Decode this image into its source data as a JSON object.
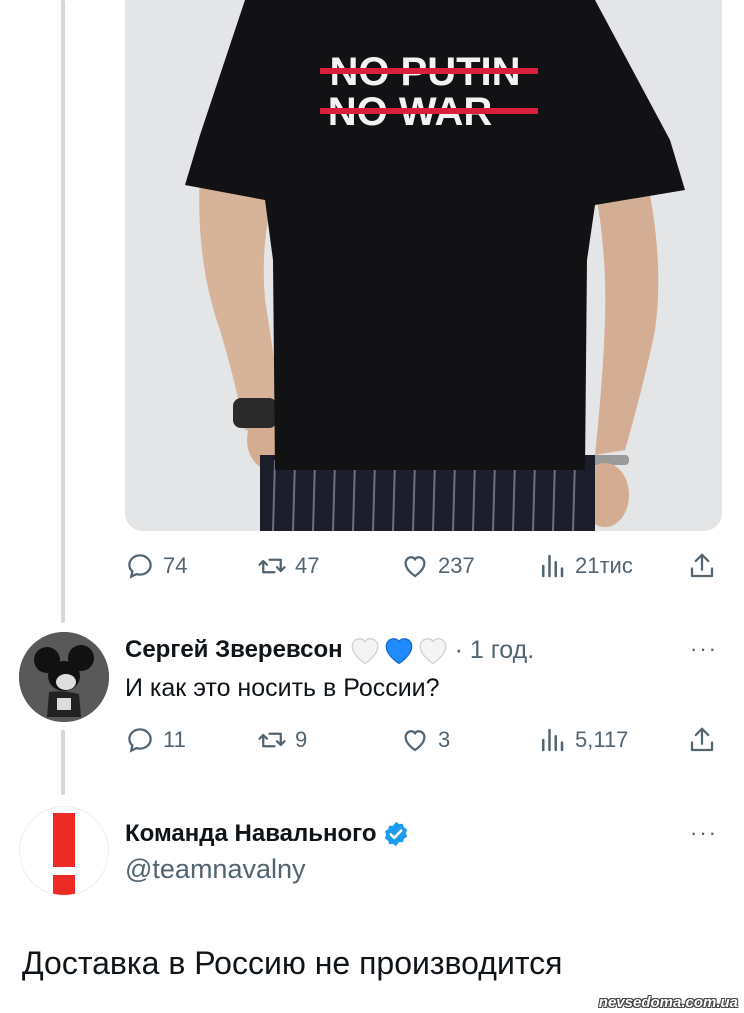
{
  "photo": {
    "shirt_line1": "NO PUTIN",
    "shirt_line2": "NO WAR",
    "accent_red": "#d81f3b"
  },
  "tweet1_actions": {
    "replies": "74",
    "retweets": "47",
    "likes": "237",
    "views": "21тис"
  },
  "reply": {
    "author": "Сергей Зверевсон",
    "emojis": [
      "white-heart",
      "blue-heart",
      "white-heart"
    ],
    "time": "· 1 год.",
    "text": "И как это носить в России?",
    "more": "···",
    "actions": {
      "replies": "11",
      "retweets": "9",
      "likes": "3",
      "views": "5,117"
    }
  },
  "team": {
    "author": "Команда Навального",
    "handle": "@teamnavalny",
    "more": "···",
    "text": "Доставка в Россию не производится",
    "brand_red": "#ee2a24",
    "verified_color": "#1d9bf0"
  },
  "watermark": "nevsedoma.com.ua"
}
